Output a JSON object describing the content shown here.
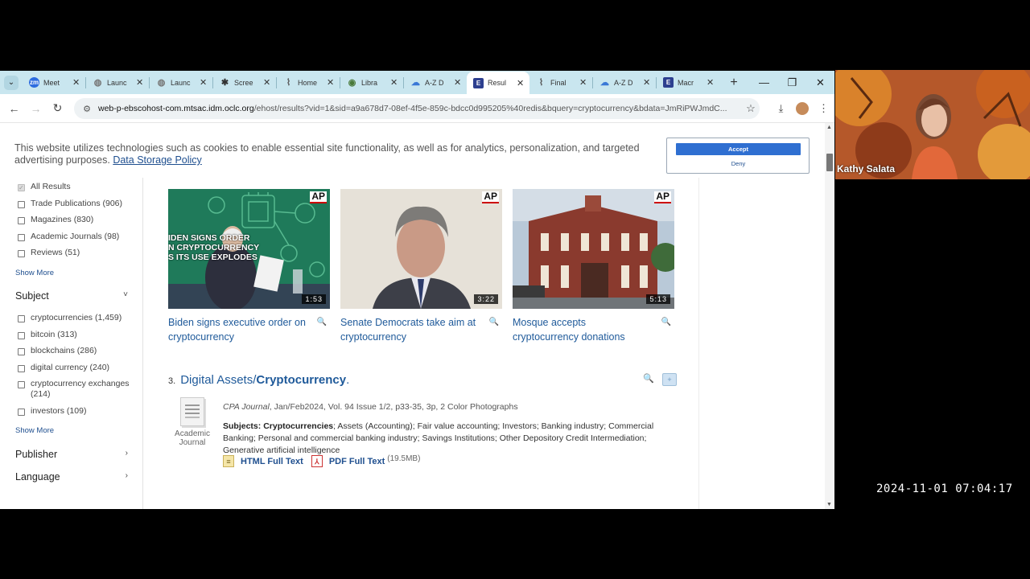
{
  "browser": {
    "tabs": [
      {
        "label": "Meet",
        "icon": "zoom",
        "color": "#2d6cdf"
      },
      {
        "label": "Launc",
        "icon": "globe",
        "color": "#777"
      },
      {
        "label": "Launc",
        "icon": "globe",
        "color": "#777"
      },
      {
        "label": "Scree",
        "icon": "gear",
        "color": "#333"
      },
      {
        "label": "Home",
        "icon": "chart",
        "color": "#555"
      },
      {
        "label": "Libra",
        "icon": "library",
        "color": "#4a7a3a"
      },
      {
        "label": "A-Z D",
        "icon": "cloud",
        "color": "#3a78d6"
      },
      {
        "label": "Resul",
        "icon": "ebsco",
        "color": "#2d3f8f"
      },
      {
        "label": "Final",
        "icon": "chart",
        "color": "#555"
      },
      {
        "label": "A-Z D",
        "icon": "cloud",
        "color": "#3a78d6"
      },
      {
        "label": "Macr",
        "icon": "ebsco",
        "color": "#2d3f8f"
      }
    ],
    "active_tab_index": 7,
    "url_domain": "web-p-ebscohost-com.mtsac.idm.oclc.org",
    "url_path": "/ehost/results?vid=1&sid=a9a678d7-08ef-4f5e-859c-bdcc0d995205%40redis&bquery=cryptocurrency&bdata=JmRiPWJmdC..."
  },
  "cookie_banner": {
    "text": "This website utilizes technologies such as cookies to enable essential site functionality, as well as for analytics, personalization, and targeted advertising purposes.",
    "link": "Data Storage Policy",
    "accept": "Accept",
    "deny": "Deny"
  },
  "sidebar": {
    "source_types": [
      {
        "label": "All Results",
        "checked": true
      },
      {
        "label": "Trade Publications (906)",
        "checked": false
      },
      {
        "label": "Magazines (830)",
        "checked": false
      },
      {
        "label": "Academic Journals (98)",
        "checked": false
      },
      {
        "label": "Reviews (51)",
        "checked": false
      }
    ],
    "show_more_1": "Show More",
    "subject_heading": "Subject",
    "subjects": [
      {
        "label": "cryptocurrencies (1,459)"
      },
      {
        "label": "bitcoin (313)"
      },
      {
        "label": "blockchains (286)"
      },
      {
        "label": "digital currency (240)"
      },
      {
        "label": "cryptocurrency exchanges (214)"
      },
      {
        "label": "investors (109)"
      }
    ],
    "show_more_2": "Show More",
    "publisher_heading": "Publisher",
    "language_heading": "Language"
  },
  "videos": [
    {
      "title": "Biden signs executive order on cryptocurrency",
      "duration": "1:53",
      "badge": "AP",
      "overlay": "IDEN SIGNS ORDER\nN CRYPTOCURRENCY\nS ITS USE EXPLODES"
    },
    {
      "title": "Senate Democrats take aim at cryptocurrency",
      "duration": "3:22",
      "badge": "AP"
    },
    {
      "title": "Mosque accepts cryptocurrency donations",
      "duration": "5:13",
      "badge": "AP"
    }
  ],
  "result": {
    "number": "3.",
    "title_prefix": "Digital Assets/",
    "title_bold": "Cryptocurrency",
    "title_suffix": ".",
    "doc_type_line1": "Academic",
    "doc_type_line2": "Journal",
    "source": "CPA Journal",
    "meta": ", Jan/Feb2024, Vol. 94 Issue 1/2, p33-35, 3p, 2 Color Photographs",
    "subjects_label": "Subjects:",
    "subjects_bold": "Cryptocurrencies",
    "subjects_rest": "; Assets (Accounting); Fair value accounting; Investors; Banking industry; Commercial Banking; Personal and commercial banking industry; Savings Institutions; Other Depository Credit Intermediation; Generative artificial intelligence",
    "html_link": "HTML Full Text",
    "pdf_link": "PDF Full Text",
    "pdf_size": "(19.5MB)"
  },
  "webcam": {
    "name": "Kathy Salata"
  },
  "timestamp": "2024-11-01  07:04:17"
}
